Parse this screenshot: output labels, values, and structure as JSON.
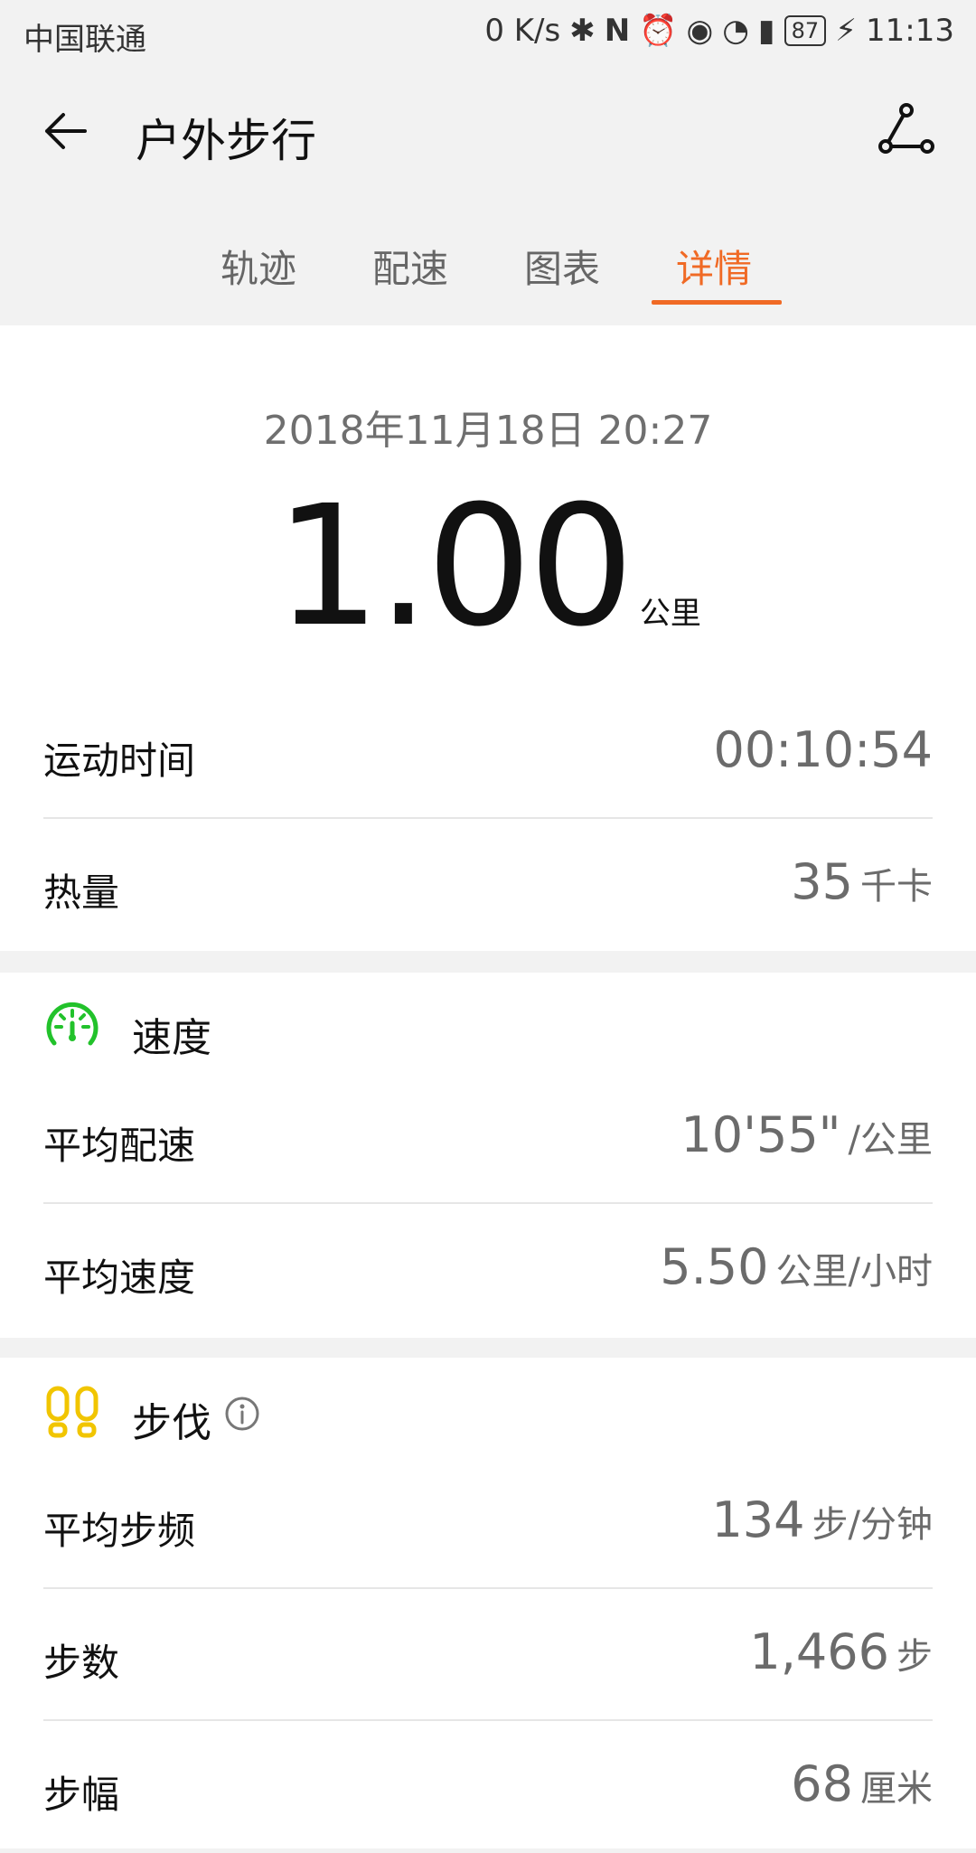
{
  "status": {
    "carrier": "中国联通",
    "speed": "0 K/s",
    "battery": "87",
    "time": "11:13"
  },
  "header": {
    "title": "户外步行"
  },
  "tabs": [
    {
      "label": "轨迹"
    },
    {
      "label": "配速"
    },
    {
      "label": "图表"
    },
    {
      "label": "详情"
    }
  ],
  "summary": {
    "datetime": "2018年11月18日 20:27",
    "distance": "1.00",
    "distance_unit": "公里"
  },
  "basic": {
    "duration_label": "运动时间",
    "duration_value": "00:10:54",
    "calories_label": "热量",
    "calories_value": "35",
    "calories_unit": "千卡"
  },
  "speed": {
    "title": "速度",
    "avg_pace_label": "平均配速",
    "avg_pace_value": "10'55\"",
    "avg_pace_unit": "/公里",
    "avg_speed_label": "平均速度",
    "avg_speed_value": "5.50",
    "avg_speed_unit": "公里/小时"
  },
  "steps": {
    "title": "步伐",
    "cadence_label": "平均步频",
    "cadence_value": "134",
    "cadence_unit": "步/分钟",
    "count_label": "步数",
    "count_value": "1,466",
    "count_unit": "步",
    "stride_label": "步幅",
    "stride_value": "68",
    "stride_unit": "厘米"
  },
  "colors": {
    "accent": "#f06a25",
    "speed_icon": "#22c22b",
    "steps_icon": "#f1c500"
  },
  "icons": {
    "back": "back-arrow-icon",
    "route": "route-share-icon",
    "speed": "speedometer-icon",
    "steps": "footprints-icon",
    "info": "info-icon"
  }
}
